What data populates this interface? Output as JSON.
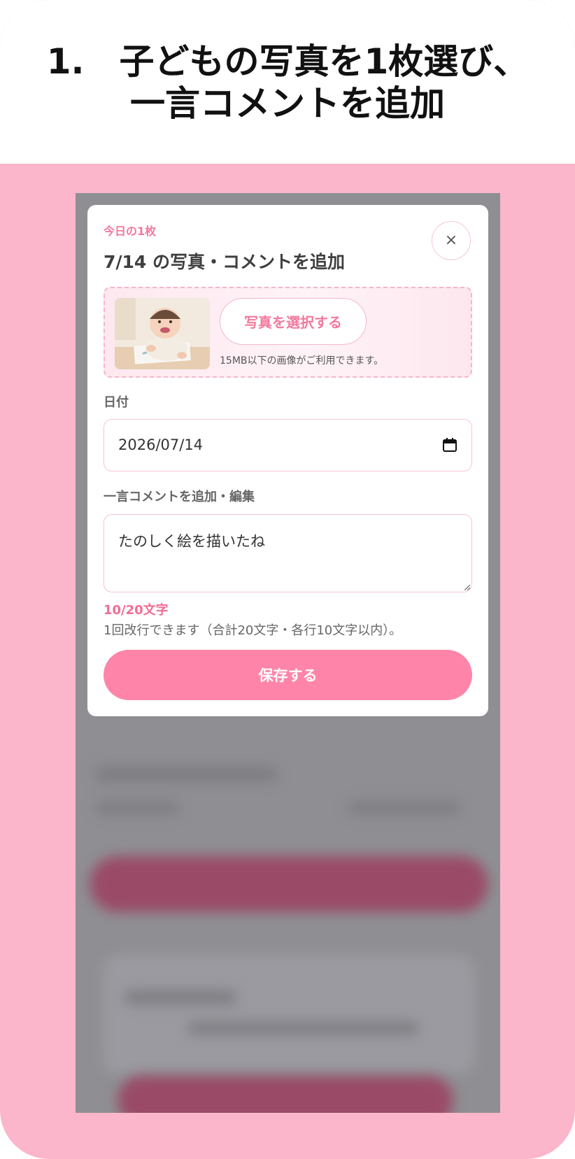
{
  "heading": {
    "line1": "1.　子どもの写真を1枚選び、",
    "line2": "一言コメントを追加"
  },
  "modal": {
    "eyebrow": "今日の1枚",
    "title": "7/14 の写真・コメントを追加",
    "close_icon": "close-icon",
    "photo": {
      "select_label": "写真を選択する",
      "note": "15MB以下の画像がご利用できます。"
    },
    "date": {
      "label": "日付",
      "value": "2026/07/14",
      "icon": "calendar-icon"
    },
    "comment": {
      "label": "一言コメントを追加・編集",
      "value": "たのしく絵を描いたね",
      "counter": "10/20文字",
      "hint": "1回改行できます（合計20文字・各行10文字以内）。"
    },
    "save_label": "保存する"
  },
  "colors": {
    "background_pink": "#fbb6cb",
    "accent_pink": "#fe85a9",
    "accent_text": "#f2799d"
  }
}
